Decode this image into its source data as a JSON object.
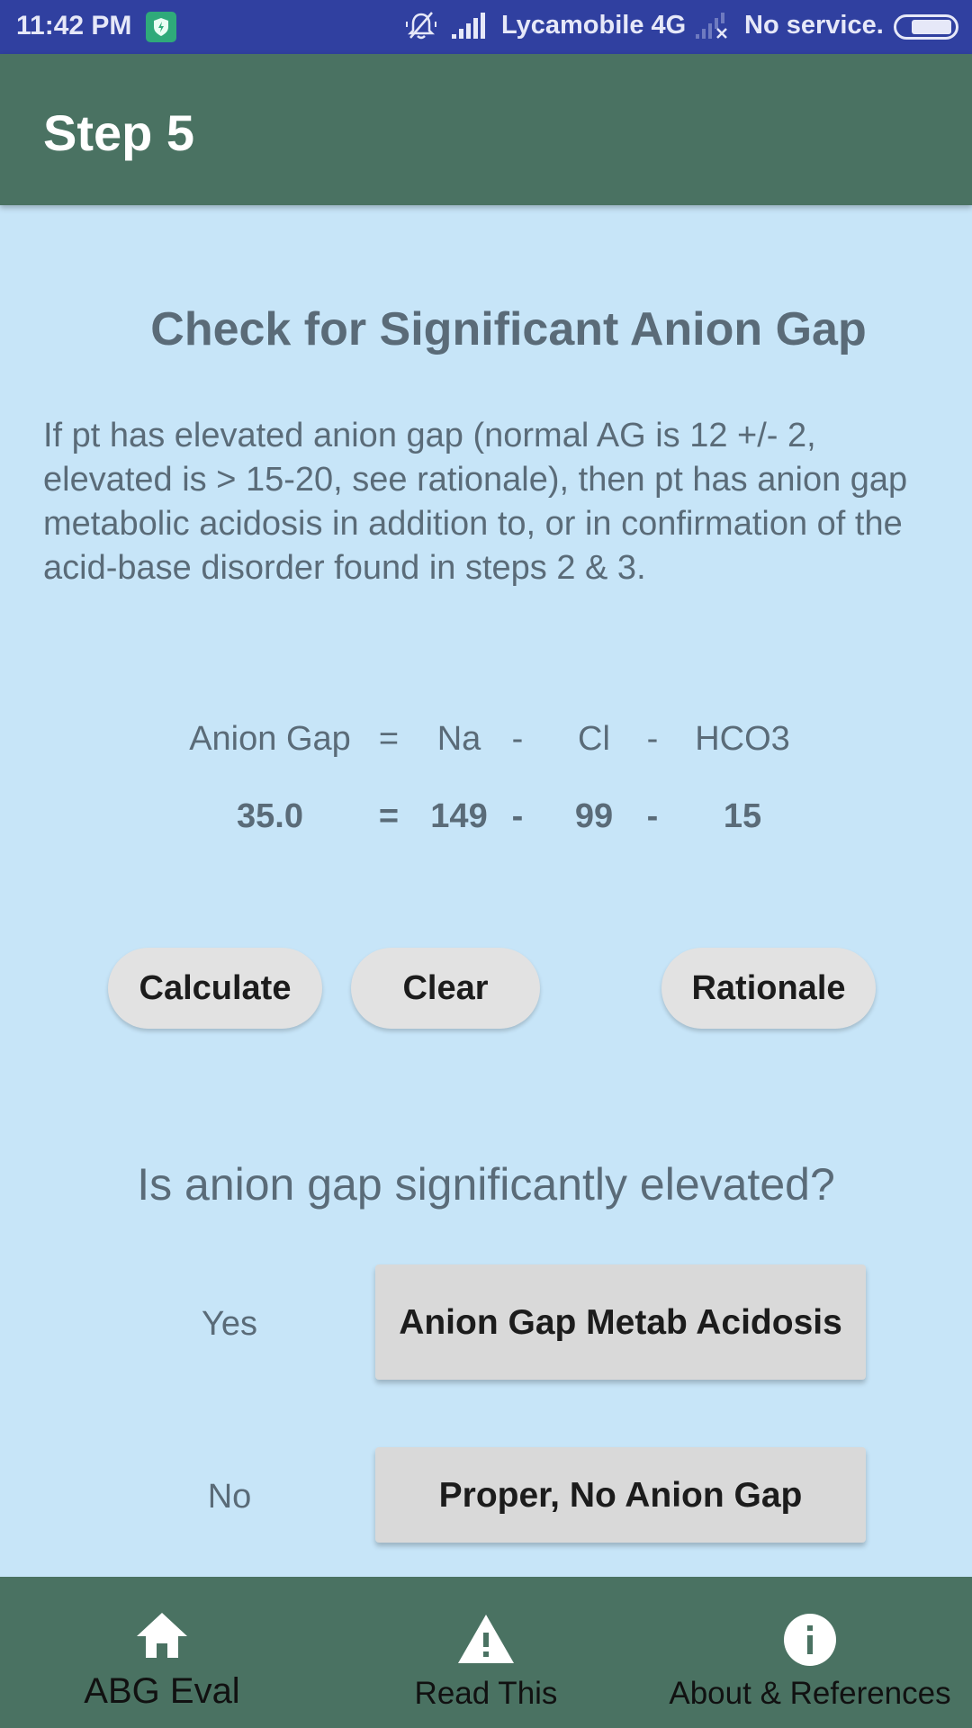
{
  "status_bar": {
    "time": "11:42 PM",
    "carrier": "Lycamobile 4G",
    "second_sim": "No service.",
    "icons": [
      "security-shield-icon",
      "mute-bell-icon",
      "signal-icon",
      "no-signal-icon",
      "battery-icon"
    ]
  },
  "app_bar": {
    "title": "Step 5"
  },
  "main": {
    "heading": "Check for Significant Anion Gap",
    "description": "If pt has elevated anion gap (normal AG is 12 +/- 2, elevated is > 15-20, see rationale), then pt has anion gap metabolic acidosis in addition to, or in confirmation of the acid-base disorder found in steps 2 & 3.",
    "formula": {
      "labels": {
        "result": "Anion Gap",
        "eq": "=",
        "na": "Na",
        "minus1": "-",
        "cl": "Cl",
        "minus2": "-",
        "hco3": "HCO3"
      },
      "values": {
        "result": "35.0",
        "eq": "=",
        "na": "149",
        "minus1": "-",
        "cl": "99",
        "minus2": "-",
        "hco3": "15"
      }
    },
    "buttons": {
      "calculate": "Calculate",
      "clear": "Clear",
      "rationale": "Rationale"
    },
    "question": "Is anion gap significantly elevated?",
    "answers": [
      {
        "label": "Yes",
        "button": "Anion Gap Metab Acidosis"
      },
      {
        "label": "No",
        "button": "Proper, No Anion Gap"
      }
    ]
  },
  "bottom_nav": {
    "items": [
      {
        "label": "ABG Eval",
        "icon": "home-icon"
      },
      {
        "label": "Read This",
        "icon": "warning-icon"
      },
      {
        "label": "About & References",
        "icon": "info-icon"
      }
    ]
  },
  "colors": {
    "status_bar": "#3040a0",
    "app_bar": "#4a7262",
    "background": "#c7e5f8",
    "text_muted": "#5a6b78",
    "button_bg": "#e2e2e2"
  }
}
